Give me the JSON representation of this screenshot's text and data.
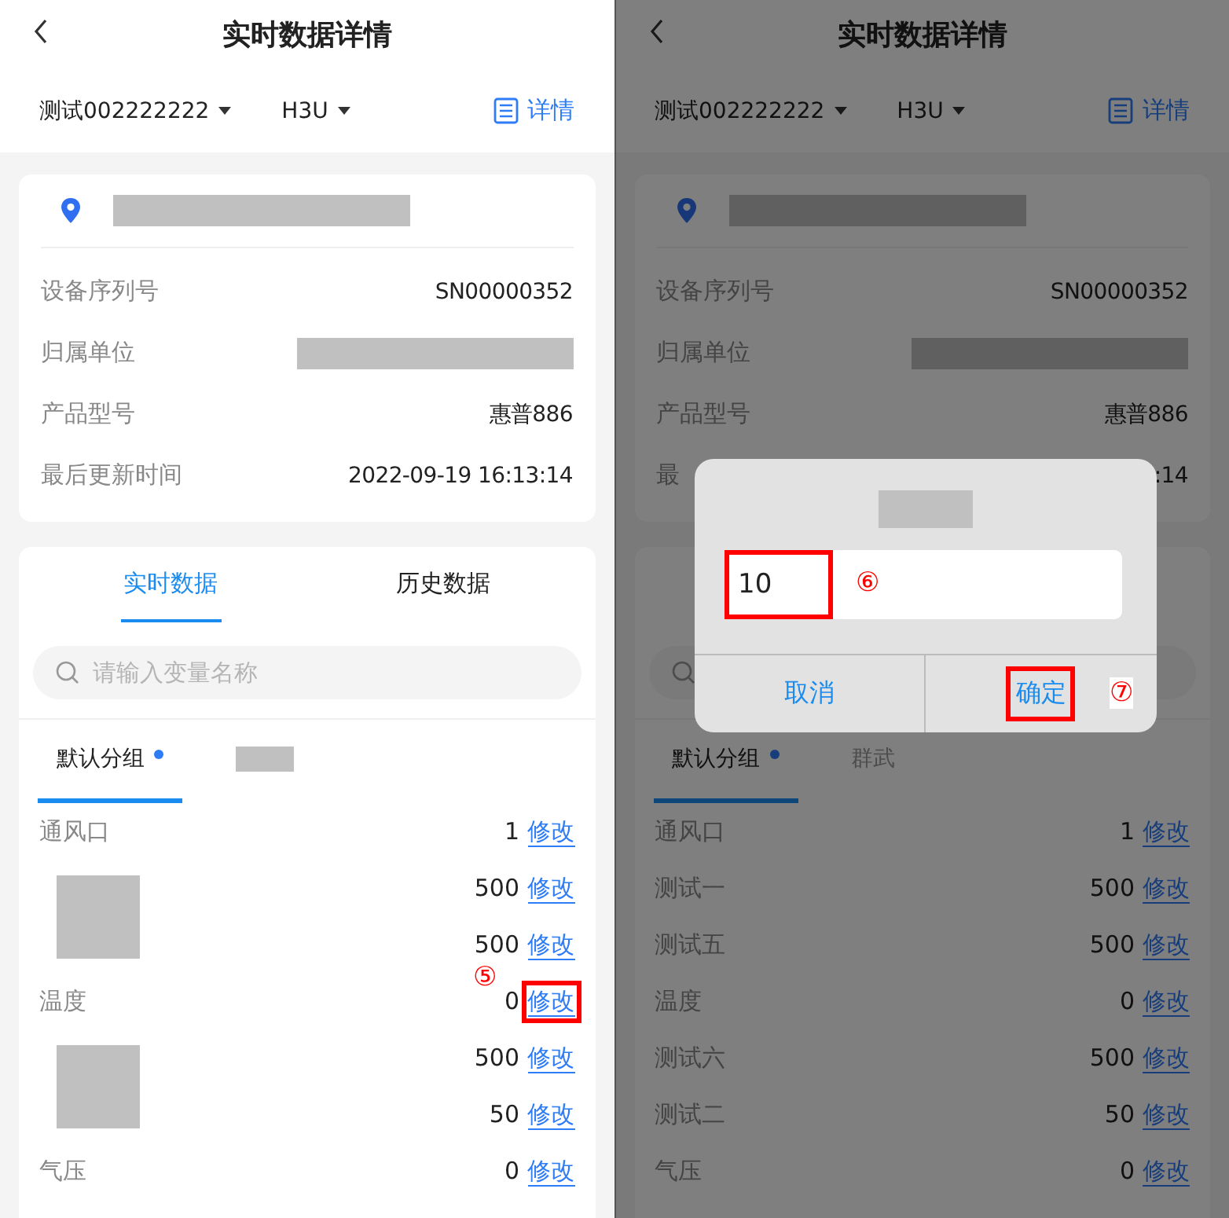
{
  "screens": [
    {
      "title": "实时数据详情",
      "device": "测试002222222",
      "model": "H3U",
      "detail_link": "详情",
      "location": {
        "redacted": true
      },
      "info_rows": [
        {
          "label": "设备序列号",
          "value": "SN00000352"
        },
        {
          "label": "归属单位",
          "redacted": true
        },
        {
          "label": "产品型号",
          "value": "惠普886"
        },
        {
          "label": "最后更新时间",
          "value": "2022-09-19 16:13:14"
        }
      ],
      "tabs": [
        {
          "label": "实时数据",
          "selected": true
        },
        {
          "label": "历史数据",
          "selected": false
        }
      ],
      "search": {
        "placeholder": "请输入变量名称"
      },
      "groups": [
        {
          "kind": "text",
          "label": "默认分组",
          "selected": true,
          "dot": true
        },
        {
          "kind": "redacted",
          "selected": false
        }
      ],
      "variables": [
        {
          "kind": "row",
          "name": "通风口",
          "value": "1",
          "action": "修改"
        },
        {
          "kind": "redacted-pair",
          "rows": [
            {
              "value": "500",
              "action": "修改"
            },
            {
              "value": "500",
              "action": "修改"
            }
          ]
        },
        {
          "kind": "row",
          "name": "温度",
          "value": "0",
          "action": "修改",
          "highlighted": true,
          "annotation": "⑤"
        },
        {
          "kind": "redacted-pair",
          "rows": [
            {
              "value": "500",
              "action": "修改"
            },
            {
              "value": "50",
              "action": "修改"
            }
          ]
        },
        {
          "kind": "row",
          "name": "气压",
          "value": "0",
          "action": "修改"
        }
      ]
    },
    {
      "dimmed": true,
      "title": "实时数据详情",
      "device": "测试002222222",
      "model": "H3U",
      "detail_link": "详情",
      "location": {
        "redacted": true
      },
      "info_rows": [
        {
          "label": "设备序列号",
          "value": "SN00000352"
        },
        {
          "label": "归属单位",
          "redacted": true
        },
        {
          "label": "产品型号",
          "value": "惠普886"
        },
        {
          "label": "最",
          "value": ":14"
        }
      ],
      "groups": [
        {
          "kind": "text",
          "label": "默认分组",
          "selected": true,
          "dot": true
        },
        {
          "kind": "text",
          "label": "群武",
          "selected": false,
          "dot": false
        }
      ],
      "variables": [
        {
          "kind": "row",
          "name": "通风口",
          "value": "1",
          "action": "修改"
        },
        {
          "kind": "row",
          "name": "测试一",
          "value": "500",
          "action": "修改"
        },
        {
          "kind": "row",
          "name": "测试五",
          "value": "500",
          "action": "修改"
        },
        {
          "kind": "row",
          "name": "温度",
          "value": "0",
          "action": "修改"
        },
        {
          "kind": "row",
          "name": "测试六",
          "value": "500",
          "action": "修改"
        },
        {
          "kind": "row",
          "name": "测试二",
          "value": "50",
          "action": "修改"
        },
        {
          "kind": "row",
          "name": "气压",
          "value": "0",
          "action": "修改"
        }
      ],
      "dialog": {
        "title": {
          "redacted": true
        },
        "input": {
          "value": "10",
          "highlighted": true,
          "annotation": "⑥"
        },
        "buttons": [
          {
            "label": "取消",
            "highlighted": false
          },
          {
            "label": "确定",
            "highlighted": true,
            "annotation": "⑦"
          }
        ]
      }
    }
  ]
}
